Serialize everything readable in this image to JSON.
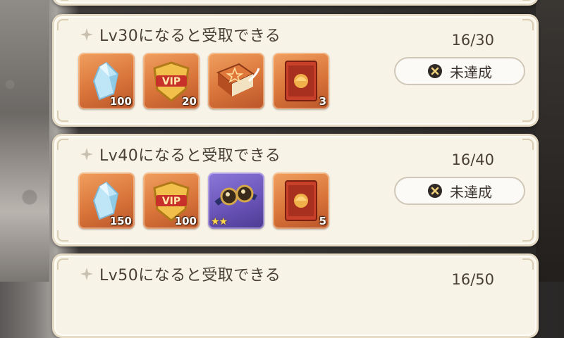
{
  "missions": [
    {
      "title": "Lv30になると受取できる",
      "progress": "16/30",
      "status_label": "未達成",
      "rewards": [
        {
          "name": "crystal-icon",
          "qty": "100",
          "bg": "orange"
        },
        {
          "name": "vip-badge-icon",
          "qty": "20",
          "bg": "orange"
        },
        {
          "name": "spellbook-icon",
          "qty": "",
          "bg": "orange"
        },
        {
          "name": "scroll-ticket-icon",
          "qty": "3",
          "bg": "orange"
        }
      ]
    },
    {
      "title": "Lv40になると受取できる",
      "progress": "16/40",
      "status_label": "未達成",
      "rewards": [
        {
          "name": "crystal-icon",
          "qty": "150",
          "bg": "orange"
        },
        {
          "name": "vip-badge-icon",
          "qty": "100",
          "bg": "orange"
        },
        {
          "name": "goggles-icon",
          "qty": "",
          "bg": "purple",
          "stars": "★★"
        },
        {
          "name": "scroll-ticket-icon",
          "qty": "5",
          "bg": "orange"
        }
      ]
    },
    {
      "title": "Lv50になると受取できる",
      "progress": "16/50"
    }
  ],
  "colors": {
    "card_bg": "#f8f3e7",
    "text": "#4a3f36",
    "reward_orange": "#d9743a",
    "reward_purple": "#6a55b8"
  }
}
